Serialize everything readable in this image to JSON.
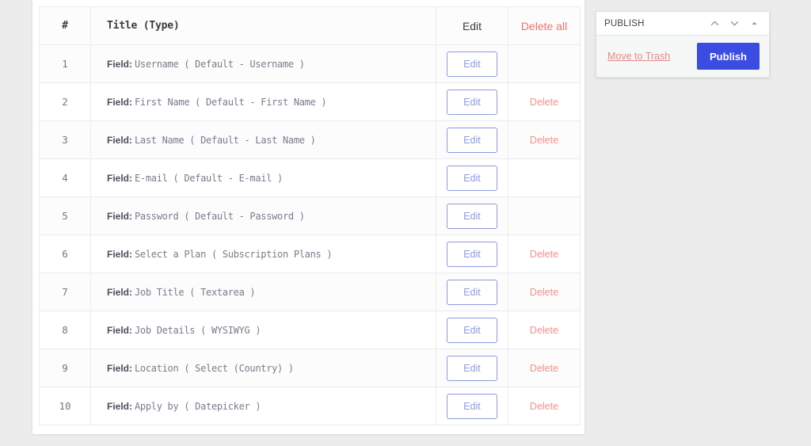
{
  "table": {
    "columns": {
      "number": "#",
      "title": "Title (Type)",
      "edit": "Edit",
      "delete_all": "Delete all"
    },
    "field_prefix": "Field:",
    "edit_label": "Edit",
    "delete_label": "Delete",
    "rows": [
      {
        "index": "1",
        "field_prefix": "Field:",
        "description": "Username ( Default - Username )",
        "edit_label": "Edit",
        "delete_label": "",
        "deletable": false
      },
      {
        "index": "2",
        "field_prefix": "Field:",
        "description": "First Name ( Default - First Name )",
        "edit_label": "Edit",
        "delete_label": "Delete",
        "deletable": true
      },
      {
        "index": "3",
        "field_prefix": "Field:",
        "description": "Last Name ( Default - Last Name )",
        "edit_label": "Edit",
        "delete_label": "Delete",
        "deletable": true
      },
      {
        "index": "4",
        "field_prefix": "Field:",
        "description": "E-mail ( Default - E-mail )",
        "edit_label": "Edit",
        "delete_label": "",
        "deletable": false
      },
      {
        "index": "5",
        "field_prefix": "Field:",
        "description": "Password ( Default - Password )",
        "edit_label": "Edit",
        "delete_label": "",
        "deletable": false
      },
      {
        "index": "6",
        "field_prefix": "Field:",
        "description": "Select a Plan ( Subscription Plans )",
        "edit_label": "Edit",
        "delete_label": "Delete",
        "deletable": true
      },
      {
        "index": "7",
        "field_prefix": "Field:",
        "description": "Job Title ( Textarea )",
        "edit_label": "Edit",
        "delete_label": "Delete",
        "deletable": true
      },
      {
        "index": "8",
        "field_prefix": "Field:",
        "description": "Job Details ( WYSIWYG )",
        "edit_label": "Edit",
        "delete_label": "Delete",
        "deletable": true
      },
      {
        "index": "9",
        "field_prefix": "Field:",
        "description": "Location ( Select (Country) )",
        "edit_label": "Edit",
        "delete_label": "Delete",
        "deletable": true
      },
      {
        "index": "10",
        "field_prefix": "Field:",
        "description": "Apply by ( Datepicker )",
        "edit_label": "Edit",
        "delete_label": "Delete",
        "deletable": true
      }
    ]
  },
  "publish_box": {
    "title": "PUBLISH",
    "icons": [
      {
        "name": "chevron-up-icon"
      },
      {
        "name": "chevron-down-icon"
      },
      {
        "name": "toggle-collapse-icon"
      }
    ],
    "trash_label": "Move to Trash",
    "publish_label": "Publish"
  },
  "colors": {
    "page_background": "#ececec",
    "card_background": "#ffffff",
    "border": "#ececec",
    "edit_accent": "#8c9ae0",
    "delete_accent": "#f0928f",
    "delete_all_accent": "#f2706b",
    "publish_blue": "#3b4ce2",
    "trash_link": "#e08a87",
    "text_primary": "#3c3c3c",
    "text_mono": "#787d8a"
  }
}
